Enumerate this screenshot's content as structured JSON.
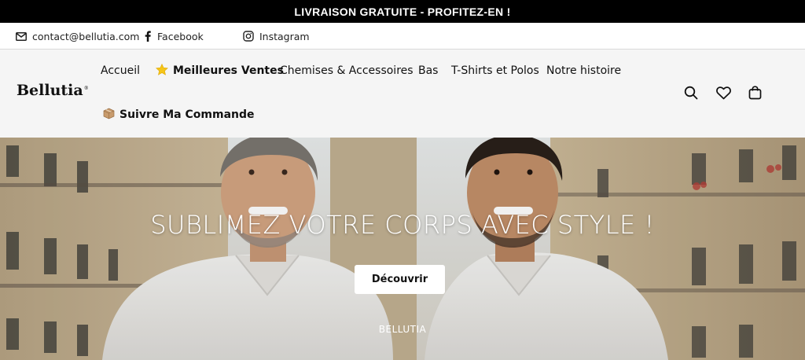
{
  "announcement": {
    "text": "LIVRAISON GRATUITE - PROFITEZ-EN !"
  },
  "contact": {
    "email": "contact@bellutia.com",
    "facebook": "Facebook",
    "instagram": "Instagram"
  },
  "header": {
    "logo": "Bellutia",
    "logo_mark": "®",
    "nav": {
      "home": "Accueil",
      "best_sellers": "Meilleures Ventes",
      "shirts": "Chemises & Accessoires",
      "bottoms": "Bas",
      "tshirts": "T-Shirts et Polos",
      "story": "Notre histoire",
      "track": "Suivre Ma Commande"
    },
    "icons": [
      "search-icon",
      "heart-icon",
      "bag-icon"
    ]
  },
  "hero": {
    "title": "SUBLIMEZ VOTRE CORPS AVEC STYLE !",
    "button": "Découvrir",
    "brand": "BELLUTIA"
  },
  "colors": {
    "announcement_bg": "#000000",
    "header_bg": "#f5f5f5",
    "star": "#f5c518"
  }
}
